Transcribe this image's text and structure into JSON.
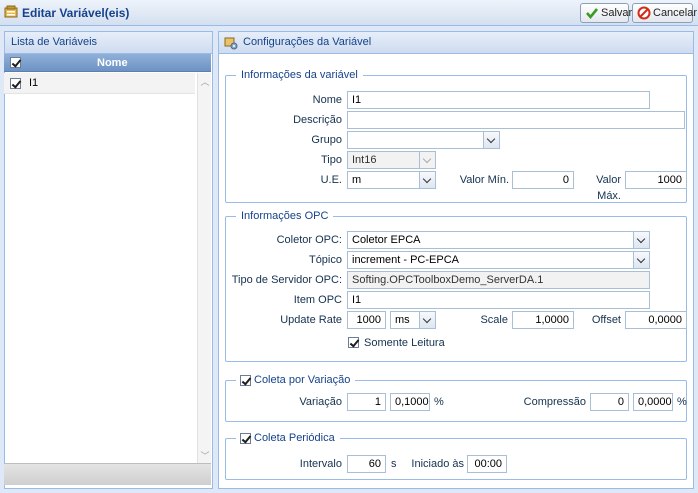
{
  "window": {
    "title": "Editar Variável(eis)"
  },
  "toolbar": {
    "save_label": "Salvar",
    "cancel_label": "Cancelar"
  },
  "left_panel": {
    "title": "Lista de Variáveis",
    "column_header": "Nome",
    "rows": [
      {
        "name": "I1",
        "checked": true
      }
    ]
  },
  "right_panel": {
    "title": "Configurações da Variável",
    "var_info": {
      "legend": "Informações da variável",
      "nome_label": "Nome",
      "nome_value": "I1",
      "descricao_label": "Descrição",
      "descricao_value": "",
      "grupo_label": "Grupo",
      "grupo_value": "",
      "tipo_label": "Tipo",
      "tipo_value": "Int16",
      "ue_label": "U.E.",
      "ue_value": "m",
      "valor_min_label": "Valor Mín.",
      "valor_min_value": "0",
      "valor_max_label": "Valor Máx.",
      "valor_max_value": "1000"
    },
    "opc_info": {
      "legend": "Informações OPC",
      "coletor_label": "Coletor OPC:",
      "coletor_value": "Coletor EPCA",
      "topico_label": "Tópico",
      "topico_value": "increment - PC-EPCA",
      "servidor_label": "Tipo de Servidor OPC:",
      "servidor_value": "Softing.OPCToolboxDemo_ServerDA.1",
      "item_label": "Item OPC",
      "item_value": "I1",
      "update_label": "Update Rate",
      "update_value": "1000",
      "update_unit": "ms",
      "scale_label": "Scale",
      "scale_value": "1,0000",
      "offset_label": "Offset",
      "offset_value": "0,0000",
      "readonly_label": "Somente Leitura",
      "readonly_checked": true
    },
    "variacao": {
      "legend": "Coleta por Variação",
      "checked": true,
      "variacao_label": "Variação",
      "variacao_value": "1",
      "variacao_pct": "0,1000",
      "pct_unit": "%",
      "compressao_label": "Compressão",
      "compressao_value": "0",
      "compressao_pct": "0,0000",
      "pct_unit2": "%"
    },
    "periodica": {
      "legend": "Coleta Periódica",
      "checked": true,
      "intervalo_label": "Intervalo",
      "intervalo_value": "60",
      "intervalo_unit": "s",
      "iniciado_label": "Iniciado às",
      "iniciado_value": "00:00"
    }
  },
  "colors": {
    "accent": "#15428b",
    "border": "#99bbe8",
    "background": "#dfe8f6"
  }
}
